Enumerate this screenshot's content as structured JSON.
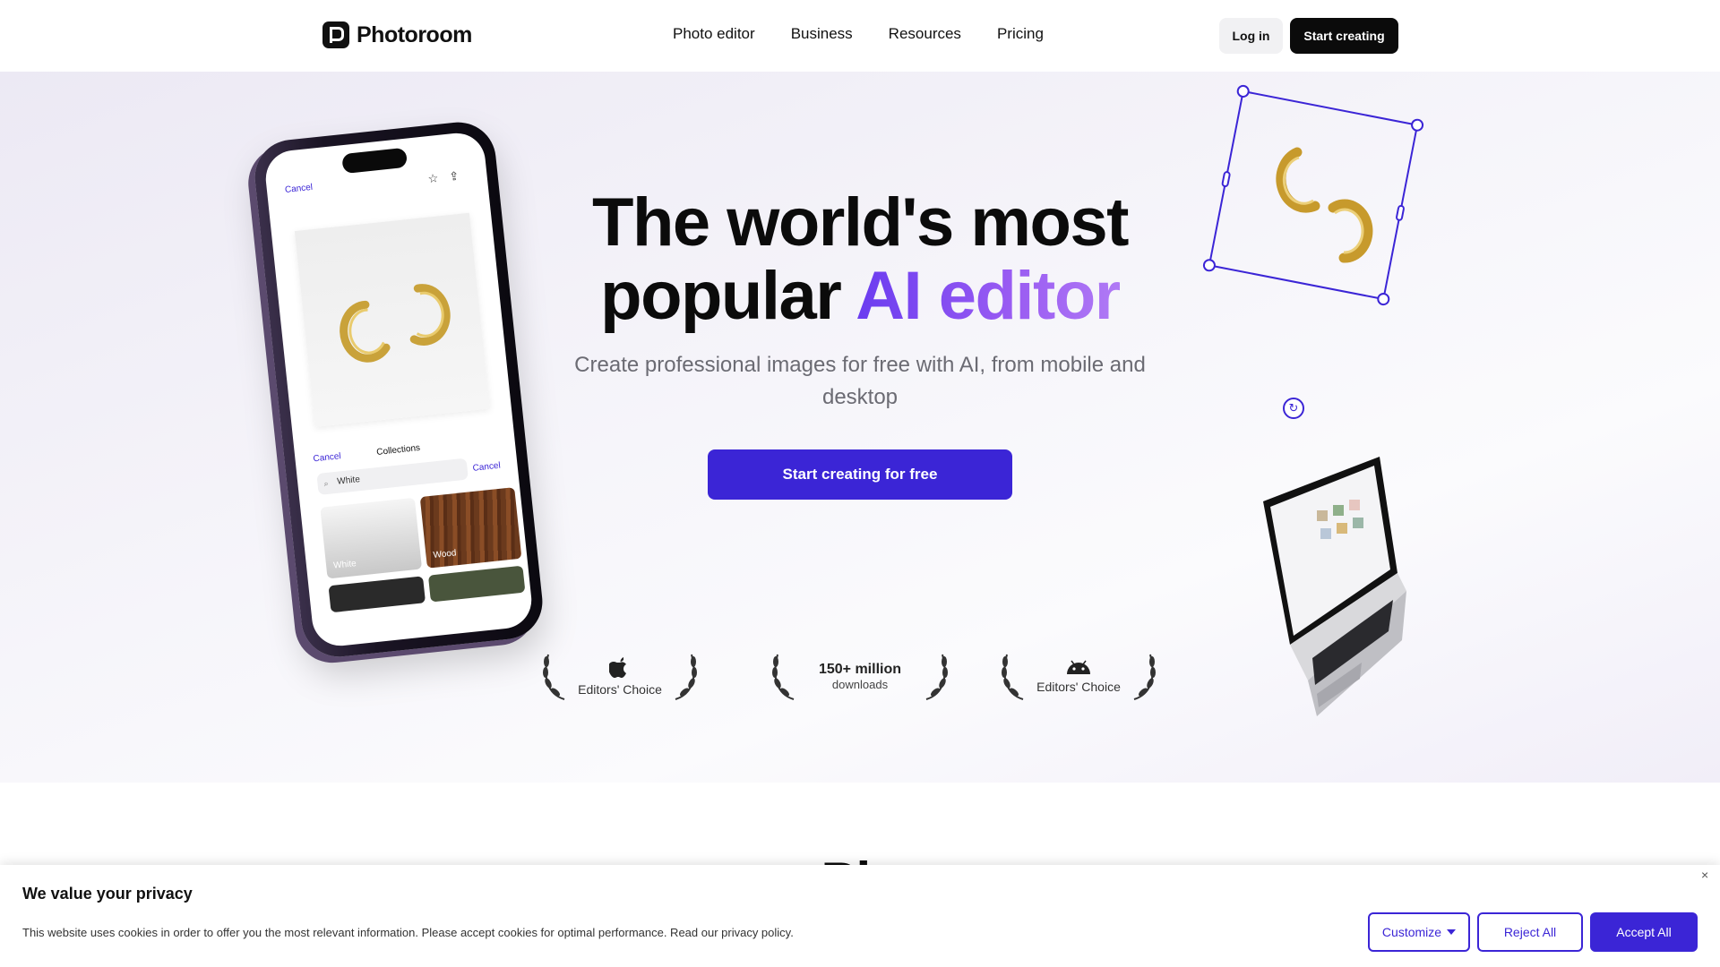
{
  "nav": {
    "logo_text": "Photoroom",
    "links": [
      "Photo editor",
      "Business",
      "Resources",
      "Pricing"
    ],
    "login_label": "Log in",
    "start_label": "Start creating"
  },
  "hero": {
    "headline_line1": "The world's most",
    "headline_line2_plain": "popular",
    "headline_line2_accent": "AI editor",
    "subheadline": "Create professional images for free with AI, from mobile and desktop",
    "cta_label": "Start creating for free",
    "accent_color": "#3b25d6"
  },
  "awards": [
    {
      "icon": "apple-icon",
      "label": "Editors' Choice"
    },
    {
      "big": "150+ million",
      "small": "downloads"
    },
    {
      "icon": "android-icon",
      "label": "Editors' Choice"
    }
  ],
  "phone": {
    "cancel_top": "Cancel",
    "tab_cancel": "Cancel",
    "tab_collections": "Collections",
    "search_value": "White",
    "search_cancel": "Cancel",
    "tiles": [
      "White",
      "Wood"
    ]
  },
  "section2": {
    "title_partial": "Pic"
  },
  "cookie": {
    "title": "We value your privacy",
    "text": "This website uses cookies in order to offer you the most relevant information. Please accept cookies for optimal performance. Read our privacy policy.",
    "customize_label": "Customize",
    "reject_label": "Reject All",
    "accept_label": "Accept All",
    "close_glyph": "×"
  }
}
